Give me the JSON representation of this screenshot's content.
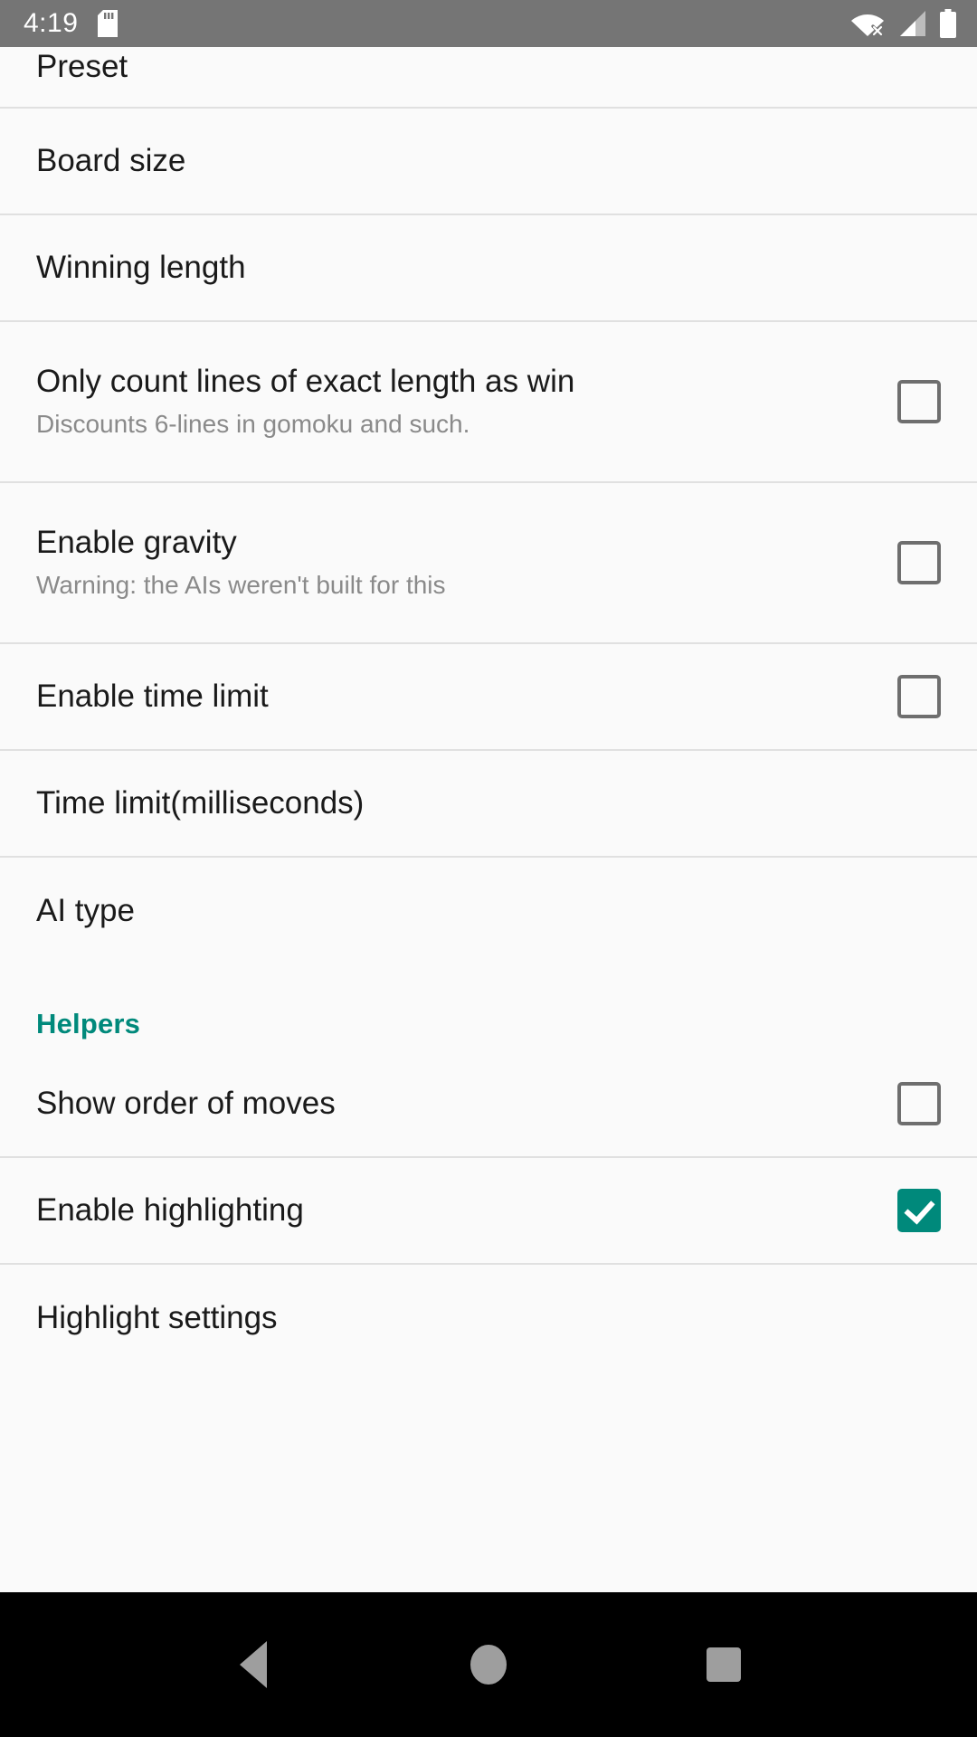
{
  "status_bar": {
    "time": "4:19",
    "icons": [
      "sd-card-icon",
      "wifi-off-icon",
      "cellular-signal-icon",
      "battery-icon"
    ],
    "background": "#757575"
  },
  "theme": {
    "accent": "#00897b",
    "page_background": "#fafafa",
    "divider": "#e0e0e0",
    "title_color": "#1a1a1a",
    "summary_color": "#8a8a8a"
  },
  "settings": {
    "rows": [
      {
        "title": "Preset",
        "summary": "",
        "control": "none",
        "checked": false,
        "clipped": true
      },
      {
        "title": "Board size",
        "summary": "",
        "control": "none",
        "checked": false
      },
      {
        "title": "Winning length",
        "summary": "",
        "control": "none",
        "checked": false
      },
      {
        "title": "Only count lines of exact length as win",
        "summary": "Discounts 6-lines in gomoku and such.",
        "control": "checkbox",
        "checked": false
      },
      {
        "title": "Enable gravity",
        "summary": "Warning: the AIs weren't built for this",
        "control": "checkbox",
        "checked": false
      },
      {
        "title": "Enable time limit",
        "summary": "",
        "control": "checkbox",
        "checked": false
      },
      {
        "title": "Time limit(milliseconds)",
        "summary": "",
        "control": "none",
        "checked": false
      },
      {
        "title": "AI type",
        "summary": "",
        "control": "none",
        "checked": false
      }
    ],
    "helpers_header": "Helpers",
    "helper_rows": [
      {
        "title": "Show order of moves",
        "summary": "",
        "control": "checkbox",
        "checked": false
      },
      {
        "title": "Enable highlighting",
        "summary": "",
        "control": "checkbox",
        "checked": true
      },
      {
        "title": "Highlight settings",
        "summary": "",
        "control": "none",
        "checked": false
      }
    ]
  },
  "nav_bar": {
    "back_label": "Back",
    "home_label": "Home",
    "recents_label": "Recents",
    "background": "#000000"
  }
}
